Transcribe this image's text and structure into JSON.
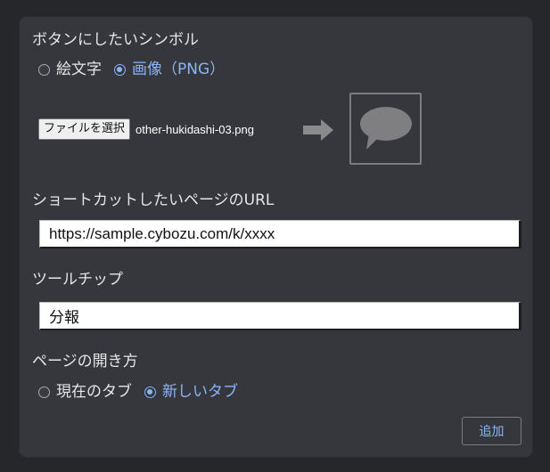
{
  "symbol_section": {
    "heading": "ボタンにしたいシンボル",
    "options": [
      {
        "label": "絵文字",
        "selected": false
      },
      {
        "label": "画像（PNG）",
        "selected": true
      }
    ],
    "file_button_label": "ファイルを選択",
    "file_name": "other-hukidashi-03.png",
    "preview_icon": "speech-bubble-icon"
  },
  "url_section": {
    "heading": "ショートカットしたいページのURL",
    "value": "https://sample.cybozu.com/k/xxxx"
  },
  "tooltip_section": {
    "heading": "ツールチップ",
    "value": "分報"
  },
  "open_section": {
    "heading": "ページの開き方",
    "options": [
      {
        "label": "現在のタブ",
        "selected": false
      },
      {
        "label": "新しいタブ",
        "selected": true
      }
    ]
  },
  "add_button_label": "追加",
  "colors": {
    "accent": "#8ab4f8",
    "panel": "#36373c",
    "background": "#26272b"
  }
}
